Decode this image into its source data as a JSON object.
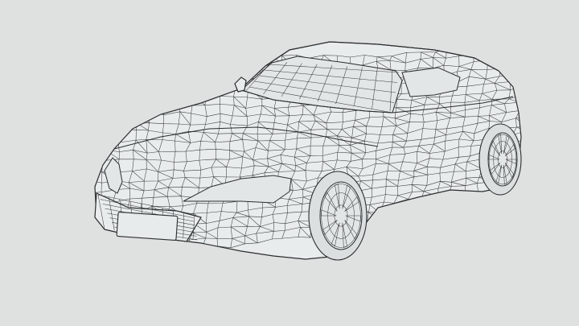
{
  "scene": {
    "subject": "wireframe-sports-car",
    "background_color": "#dfe0e0",
    "line_color": "#3a3d3f",
    "surface_color": "#e9ecec"
  }
}
